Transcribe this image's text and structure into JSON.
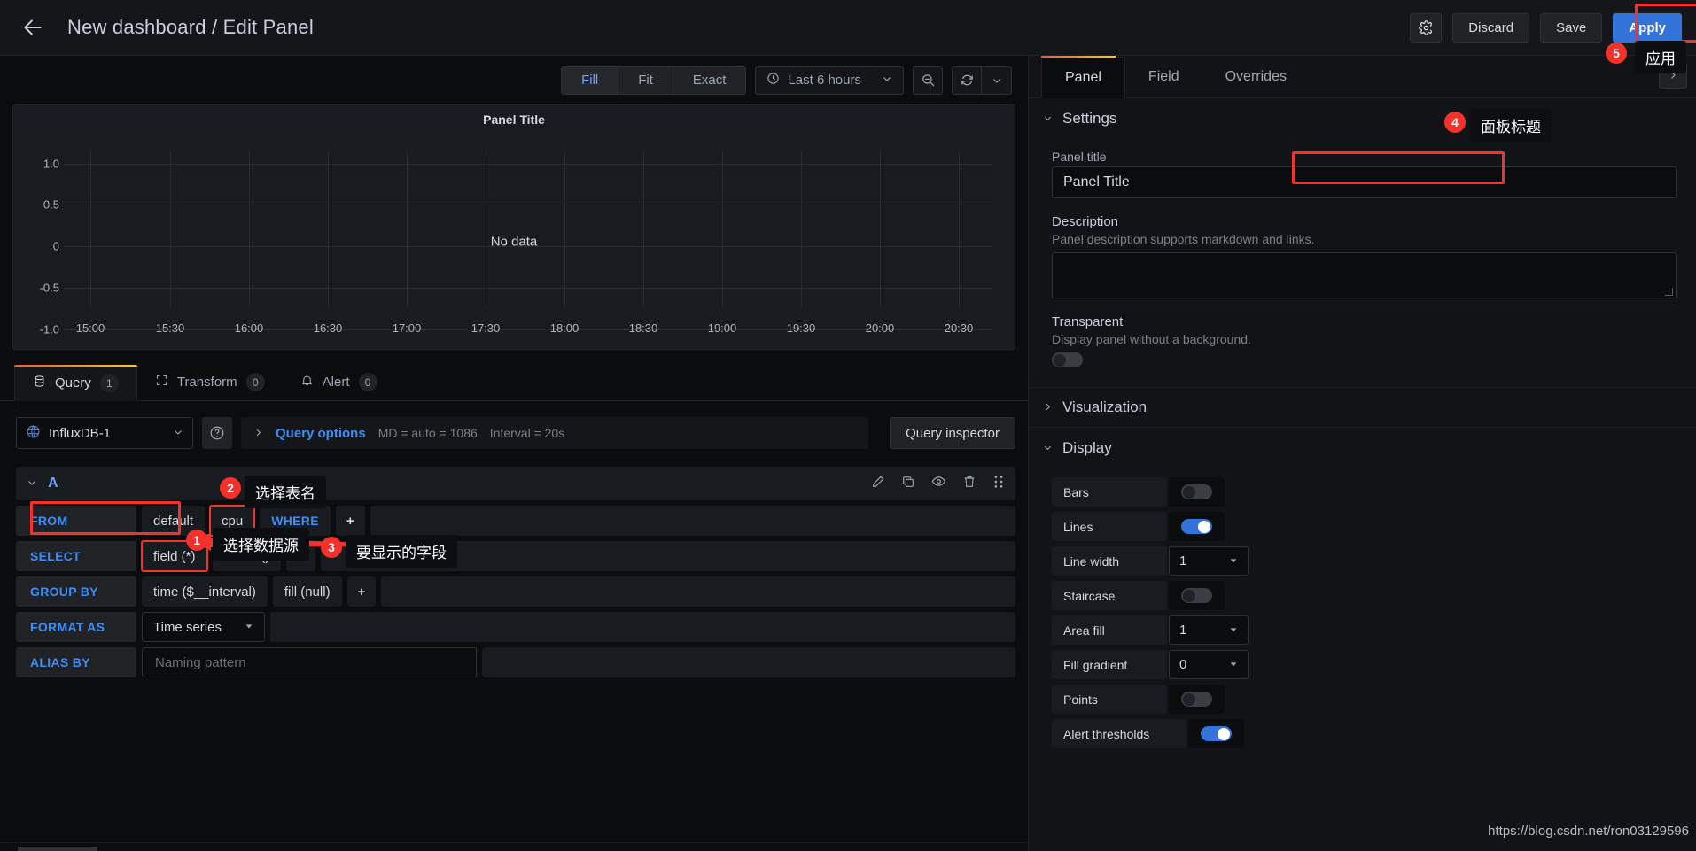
{
  "topnav": {
    "back_icon": "arrow-left-icon",
    "title": "New dashboard / Edit Panel",
    "gear_icon": "gear-icon",
    "discard_label": "Discard",
    "save_label": "Save",
    "apply_label": "Apply"
  },
  "annotations": [
    {
      "num": "1",
      "text": "选择数据源"
    },
    {
      "num": "2",
      "text": "选择表名"
    },
    {
      "num": "3",
      "text": "要显示的字段"
    },
    {
      "num": "4",
      "text": "面板标题"
    },
    {
      "num": "5",
      "text": "应用"
    }
  ],
  "viz_toolbar": {
    "segments": [
      {
        "label": "Fill",
        "active": true
      },
      {
        "label": "Fit",
        "active": false
      },
      {
        "label": "Exact",
        "active": false
      }
    ],
    "time_range": "Last 6 hours",
    "clock_icon": "clock-icon",
    "zoom_out_icon": "zoom-out-icon",
    "refresh_icon": "refresh-icon",
    "chevron_icon": "chevron-down-icon"
  },
  "chart_data": {
    "type": "line",
    "title": "Panel Title",
    "empty_message": "No data",
    "series": [],
    "x": [
      "15:00",
      "15:30",
      "16:00",
      "16:30",
      "17:00",
      "17:30",
      "18:00",
      "18:30",
      "19:00",
      "19:30",
      "20:00",
      "20:30"
    ],
    "xlabel": "",
    "ylabel": "",
    "yticks": [
      "1.0",
      "0.5",
      "0",
      "-0.5",
      "-1.0"
    ],
    "ylim": [
      -1.0,
      1.0
    ],
    "grid": true,
    "legend": "none"
  },
  "query_tabs": [
    {
      "label": "Query",
      "count": "1",
      "icon": "database-icon",
      "active": true
    },
    {
      "label": "Transform",
      "count": "0",
      "icon": "transform-icon",
      "active": false
    },
    {
      "label": "Alert",
      "count": "0",
      "icon": "bell-icon",
      "active": false
    }
  ],
  "datasource": {
    "name": "InfluxDB-1",
    "icon": "influxdb-icon",
    "chevron_icon": "chevron-down-icon",
    "help_icon": "help-circle-icon",
    "query_options_label": "Query options",
    "md_text": "MD = auto = 1086",
    "interval_text": "Interval = 20s",
    "query_inspector_label": "Query inspector"
  },
  "query_a": {
    "name": "A",
    "caret_icon": "chevron-down-icon",
    "actions": [
      "pencil-icon",
      "copy-icon",
      "eye-icon",
      "trash-icon",
      "drag-handle-icon"
    ],
    "rows": [
      {
        "key": "FROM",
        "segments": [
          {
            "text": "default",
            "highlight": false,
            "kw": false
          },
          {
            "text": "cpu",
            "highlight": true,
            "kw": false
          },
          {
            "text": "WHERE",
            "highlight": false,
            "kw": true
          },
          {
            "text": "+",
            "highlight": false,
            "kw": false
          }
        ]
      },
      {
        "key": "SELECT",
        "segments": [
          {
            "text": "field (*)",
            "highlight": true,
            "kw": false
          },
          {
            "text": "mean ()",
            "highlight": false,
            "kw": false
          },
          {
            "text": "+",
            "highlight": false,
            "kw": false
          }
        ]
      },
      {
        "key": "GROUP BY",
        "segments": [
          {
            "text": "time ($__interval)",
            "highlight": false,
            "kw": false
          },
          {
            "text": "fill (null)",
            "highlight": false,
            "kw": false
          },
          {
            "text": "+",
            "highlight": false,
            "kw": false
          }
        ]
      }
    ],
    "format_as_key": "FORMAT AS",
    "format_as_value": "Time series",
    "alias_by_key": "ALIAS BY",
    "alias_placeholder": "Naming pattern"
  },
  "options_pane": {
    "tabs": [
      {
        "label": "Panel",
        "active": true
      },
      {
        "label": "Field",
        "active": false
      },
      {
        "label": "Overrides",
        "active": false
      }
    ],
    "expand_icon": "chevron-right-icon",
    "settings": {
      "title": "Settings",
      "panel_title_label": "Panel title",
      "panel_title_value": "Panel Title",
      "description_label": "Description",
      "description_hint": "Panel description supports markdown and links.",
      "description_value": "",
      "transparent_label": "Transparent",
      "transparent_hint": "Display panel without a background.",
      "transparent_on": false
    },
    "visualization": {
      "title": "Visualization",
      "expanded": false
    },
    "display": {
      "title": "Display",
      "expanded": true,
      "items": [
        {
          "label": "Bars",
          "type": "toggle",
          "on": false
        },
        {
          "label": "Lines",
          "type": "toggle",
          "on": true
        },
        {
          "label": "Line width",
          "type": "select",
          "value": "1"
        },
        {
          "label": "Staircase",
          "type": "toggle",
          "on": false
        },
        {
          "label": "Area fill",
          "type": "select",
          "value": "1"
        },
        {
          "label": "Fill gradient",
          "type": "select",
          "value": "0"
        },
        {
          "label": "Points",
          "type": "toggle",
          "on": false
        },
        {
          "label": "Alert thresholds",
          "type": "toggle",
          "on": true
        }
      ]
    }
  },
  "watermark": "https://blog.csdn.net/ron03129596"
}
